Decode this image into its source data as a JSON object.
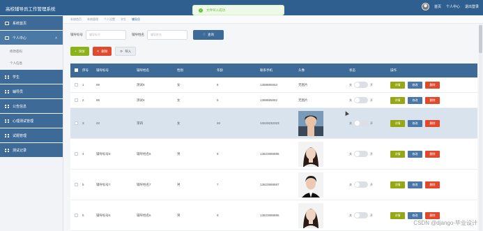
{
  "header": {
    "title": "高校辅导员工作管理系统",
    "links": [
      "首页",
      "个人中心",
      "退出登录"
    ]
  },
  "toast": {
    "message": "文件导入成功"
  },
  "sidebar": {
    "items": [
      {
        "label": "系统首页",
        "icon": "home-icon"
      },
      {
        "label": "个人中心",
        "icon": "user-card-icon",
        "expanded": true,
        "children": [
          "修改密码",
          "个人信息"
        ]
      },
      {
        "label": "学生",
        "icon": "grid-icon"
      },
      {
        "label": "辅导员",
        "icon": "grid-icon"
      },
      {
        "label": "公告信息",
        "icon": "grid-icon"
      },
      {
        "label": "心理测试管理",
        "icon": "grid-icon"
      },
      {
        "label": "试题管理",
        "icon": "grid-icon"
      },
      {
        "label": "测试记录",
        "icon": "grid-icon"
      }
    ]
  },
  "breadcrumb": [
    "系统首页",
    "系统管理",
    "个人设置",
    "学生",
    "辅导员"
  ],
  "search": {
    "no_label": "辅导标号",
    "no_placeholder": "辅导标号",
    "name_label": "辅导姓名",
    "name_placeholder": "辅导姓名",
    "query_button": "查询"
  },
  "actions": {
    "add": "添加",
    "delete": "删除",
    "import": "导入"
  },
  "table": {
    "headers": [
      "",
      "序号",
      "辅导标号",
      "辅导姓名",
      "性别",
      "年龄",
      "联系手机",
      "头像",
      "状态",
      "操作"
    ],
    "switch_off": "关",
    "switch_on": "开",
    "op_labels": {
      "detail": "详情",
      "edit": "修改",
      "delete": "删除"
    },
    "rows": [
      {
        "idx": "1",
        "no": "99",
        "name": "测试8",
        "sex": "女",
        "age": "8",
        "phone": "1388885653",
        "photo": "无图片",
        "height": 22
      },
      {
        "idx": "2",
        "no": "88",
        "name": "测试6",
        "sex": "女",
        "age": "5",
        "phone": "1388885652",
        "photo": "无图片",
        "height": 22
      },
      {
        "idx": "3",
        "no": "22",
        "name": "李四",
        "sex": "女",
        "age": "32",
        "phone": "13223232323",
        "photo": "avatar-young-man",
        "height": 44
      },
      {
        "idx": "4",
        "no": "辅导标号8",
        "name": "辅导姓名8",
        "sex": "男",
        "age": "8",
        "phone": "13823888888",
        "photo": "avatar-woman",
        "height": 44
      },
      {
        "idx": "5",
        "no": "辅导标号7",
        "name": "辅导姓名7",
        "sex": "男",
        "age": "7",
        "phone": "13823888887",
        "photo": "avatar-man",
        "height": 44
      },
      {
        "idx": "6",
        "no": "辅导标号6",
        "name": "辅导姓名6",
        "sex": "男",
        "age": "6",
        "phone": "13823888886",
        "photo": "avatar-woman",
        "height": 44
      }
    ]
  },
  "watermark": "CSDN @django-毕业设计",
  "colors": {
    "header": "#2f5f8f",
    "add": "#8bb219",
    "delete": "#e0492c",
    "edit": "#4b77a6"
  }
}
